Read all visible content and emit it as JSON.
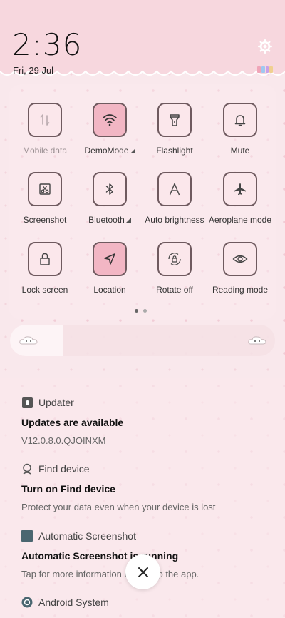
{
  "status": {
    "time": "2:36",
    "date": "Fri, 29 Jul"
  },
  "tiles": [
    {
      "label": "Mobile data",
      "icon": "mobile-data-icon",
      "state": "disabled"
    },
    {
      "label": "DemoMode",
      "icon": "wifi-icon",
      "state": "on",
      "expandable": true
    },
    {
      "label": "Flashlight",
      "icon": "flashlight-icon",
      "state": "off"
    },
    {
      "label": "Mute",
      "icon": "bell-icon",
      "state": "off"
    },
    {
      "label": "Screenshot",
      "icon": "scissors-icon",
      "state": "off"
    },
    {
      "label": "Bluetooth",
      "icon": "bluetooth-icon",
      "state": "off",
      "expandable": true
    },
    {
      "label": "Auto brightness",
      "icon": "auto-brightness-icon",
      "state": "off"
    },
    {
      "label": "Aeroplane mode",
      "icon": "airplane-icon",
      "state": "off"
    },
    {
      "label": "Lock screen",
      "icon": "lock-icon",
      "state": "off"
    },
    {
      "label": "Location",
      "icon": "location-arrow-icon",
      "state": "on"
    },
    {
      "label": "Rotate off",
      "icon": "rotate-lock-icon",
      "state": "off"
    },
    {
      "label": "Reading mode",
      "icon": "eye-icon",
      "state": "off"
    }
  ],
  "pager": {
    "current": 1,
    "total": 2
  },
  "brightness": {
    "level": 0.2
  },
  "notifications": [
    {
      "app": "Updater",
      "title": "Updates are available",
      "body": "V12.0.8.0.QJOINXM"
    },
    {
      "app": "Find device",
      "title": "Turn on Find device",
      "body": "Protect your data even when your device is lost"
    },
    {
      "app": "Automatic Screenshot",
      "title": "Automatic Screenshot is running",
      "body": "Tap for more information or to stop the app."
    },
    {
      "app": "Android System",
      "title": "",
      "body": ""
    }
  ],
  "colors": {
    "accent_on": "#f2b6c4",
    "tile_border": "#6f5a5f",
    "header": "#f7d7de"
  }
}
